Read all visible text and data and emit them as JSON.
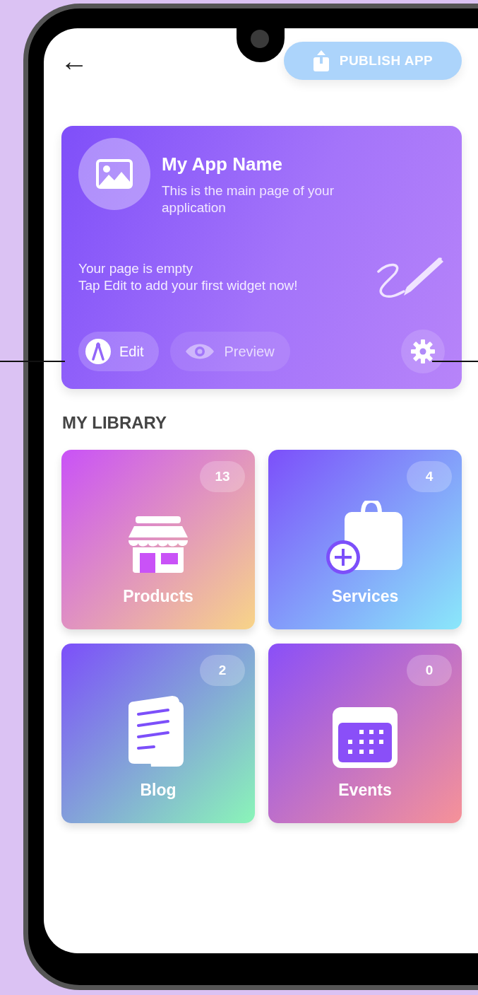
{
  "header": {
    "back": "←",
    "publish_button": "PUBLISH APP"
  },
  "app_card": {
    "title": "My App Name",
    "subtitle": "This is the main page of your application",
    "empty_message": "Your page is empty\nTap Edit to add your first widget now!",
    "buttons": [
      {
        "kind": "edit",
        "label": "Edit",
        "disabled": false
      },
      {
        "kind": "preview",
        "label": "Preview",
        "disabled": true
      }
    ]
  },
  "library": {
    "heading": "MY LIBRARY",
    "tiles": [
      {
        "kind": "store",
        "label": "Products",
        "count": "13"
      },
      {
        "kind": "bag",
        "label": "Services",
        "count": "4"
      },
      {
        "kind": "document",
        "label": "Blog",
        "count": "2"
      },
      {
        "kind": "calendar",
        "label": "Events",
        "count": "0"
      }
    ]
  }
}
